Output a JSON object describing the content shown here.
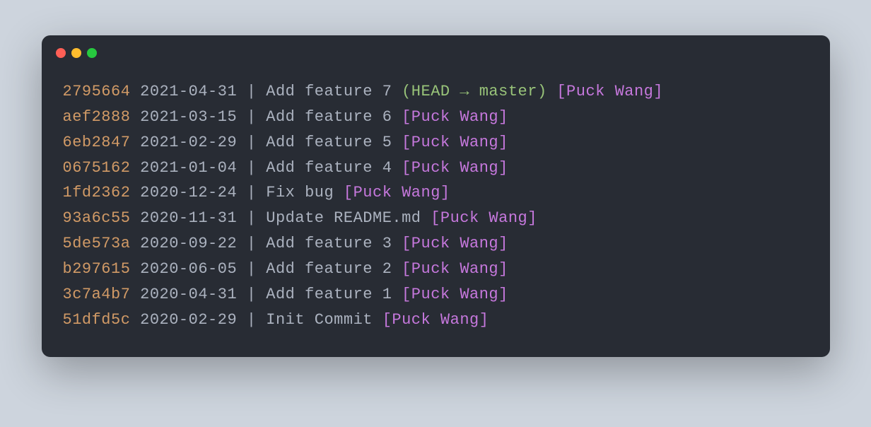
{
  "colors": {
    "bg": "#282c34",
    "hash": "#d19a66",
    "text": "#abb2bf",
    "ref": "#98c379",
    "author": "#c678dd"
  },
  "commits": [
    {
      "hash": "2795664",
      "date": "2021-04-31",
      "message": "Add feature 7",
      "ref": "(HEAD → master)",
      "author": "[Puck Wang]"
    },
    {
      "hash": "aef2888",
      "date": "2021-03-15",
      "message": "Add feature 6",
      "ref": "",
      "author": "[Puck Wang]"
    },
    {
      "hash": "6eb2847",
      "date": "2021-02-29",
      "message": "Add feature 5",
      "ref": "",
      "author": "[Puck Wang]"
    },
    {
      "hash": "0675162",
      "date": "2021-01-04",
      "message": "Add feature 4",
      "ref": "",
      "author": "[Puck Wang]"
    },
    {
      "hash": "1fd2362",
      "date": "2020-12-24",
      "message": "Fix bug",
      "ref": "",
      "author": "[Puck Wang]"
    },
    {
      "hash": "93a6c55",
      "date": "2020-11-31",
      "message": "Update README.md",
      "ref": "",
      "author": "[Puck Wang]"
    },
    {
      "hash": "5de573a",
      "date": "2020-09-22",
      "message": "Add feature 3",
      "ref": "",
      "author": "[Puck Wang]"
    },
    {
      "hash": "b297615",
      "date": "2020-06-05",
      "message": "Add feature 2",
      "ref": "",
      "author": "[Puck Wang]"
    },
    {
      "hash": "3c7a4b7",
      "date": "2020-04-31",
      "message": "Add feature 1",
      "ref": "",
      "author": "[Puck Wang]"
    },
    {
      "hash": "51dfd5c",
      "date": "2020-02-29",
      "message": "Init Commit",
      "ref": "",
      "author": "[Puck Wang]"
    }
  ]
}
